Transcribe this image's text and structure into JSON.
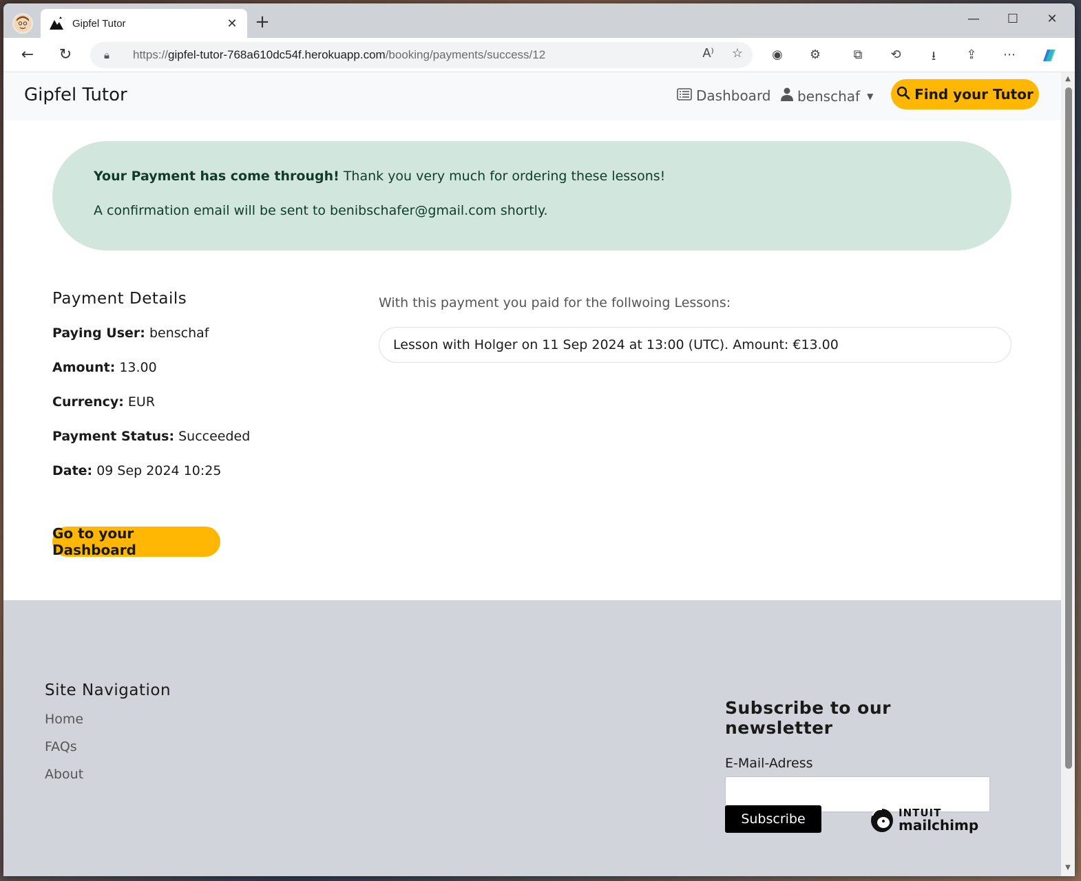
{
  "browser": {
    "tab_title": "Gipfel Tutor",
    "url_scheme": "https://",
    "url_host": "gipfel-tutor-768a610dc54f.herokuapp.com",
    "url_path": "/booking/payments/success/12"
  },
  "navbar": {
    "brand": "Gipfel Tutor",
    "dashboard_label": "Dashboard",
    "user_label": "benschaf",
    "find_tutor_label": "Find your Tutor"
  },
  "alert": {
    "headline": "Your Payment has come through!",
    "message": "Thank you very much for ordering these lessons!",
    "email_line": "A confirmation email will be sent to benibschafer@gmail.com shortly."
  },
  "payment": {
    "heading": "Payment Details",
    "rows": [
      {
        "label": "Paying User:",
        "value": "benschaf"
      },
      {
        "label": "Amount:",
        "value": "13.00"
      },
      {
        "label": "Currency:",
        "value": "EUR"
      },
      {
        "label": "Payment Status:",
        "value": "Succeeded"
      },
      {
        "label": "Date:",
        "value": "09 Sep 2024 10:25"
      }
    ],
    "dashboard_button": "Go to your Dashboard"
  },
  "lessons": {
    "intro": "With this payment you paid for the follwoing Lessons:",
    "items": [
      "Lesson with Holger on 11 Sep 2024 at 13:00 (UTC). Amount: €13.00"
    ]
  },
  "footer": {
    "nav_heading": "Site Navigation",
    "nav_links": [
      "Home",
      "FAQs",
      "About"
    ],
    "newsletter_heading": "Subscribe to our newsletter",
    "email_label": "E-Mail-Adress",
    "email_value": "",
    "subscribe_label": "Subscribe",
    "mailchimp_top": "INTUIT",
    "mailchimp_name": "mailchimp"
  },
  "colors": {
    "accent": "#ffb703",
    "alert_bg": "#d1e7dd",
    "footer_bg": "#d1d5db"
  }
}
